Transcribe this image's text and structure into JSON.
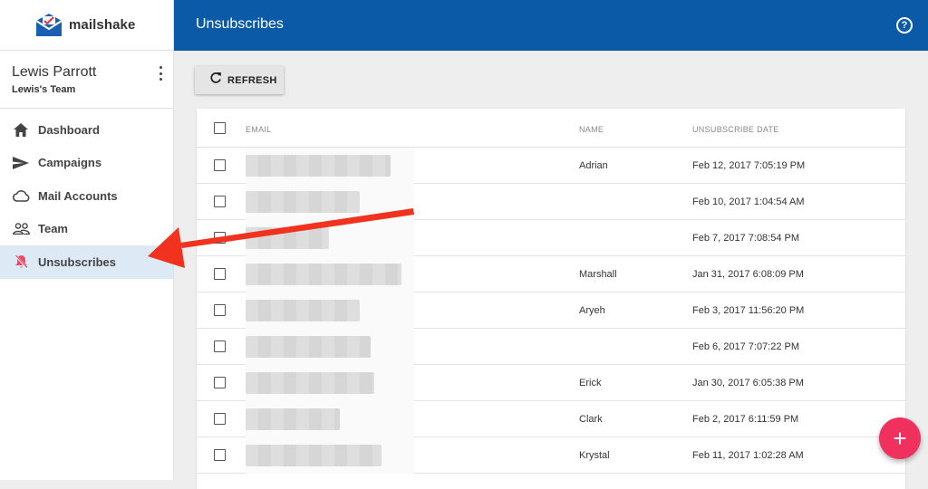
{
  "app": {
    "logo_text": "mailshake",
    "brand_color": "#0b5aa8"
  },
  "user": {
    "name": "Lewis Parrott",
    "team": "Lewis's Team"
  },
  "sidebar": {
    "items": [
      {
        "label": "Dashboard",
        "icon": "home-icon"
      },
      {
        "label": "Campaigns",
        "icon": "send-icon"
      },
      {
        "label": "Mail Accounts",
        "icon": "cloud-icon"
      },
      {
        "label": "Team",
        "icon": "people-icon"
      },
      {
        "label": "Unsubscribes",
        "icon": "bell-off-icon",
        "active": true
      }
    ]
  },
  "header": {
    "title": "Unsubscribes",
    "help": "?"
  },
  "toolbar": {
    "refresh_label": "REFRESH"
  },
  "table": {
    "columns": {
      "email": "EMAIL",
      "name": "NAME",
      "date": "UNSUBSCRIBE DATE"
    },
    "rows": [
      {
        "name": "Adrian",
        "date": "Feb 12, 2017 7:05:19 PM"
      },
      {
        "name": "",
        "date": "Feb 10, 2017 1:04:54 AM"
      },
      {
        "name": "",
        "date": "Feb 7, 2017 7:08:54 PM"
      },
      {
        "name": "Marshall",
        "date": "Jan 31, 2017 6:08:09 PM"
      },
      {
        "name": "Aryeh",
        "date": "Feb 3, 2017 11:56:20 PM"
      },
      {
        "name": "",
        "date": "Feb 6, 2017 7:07:22 PM"
      },
      {
        "name": "Erick",
        "date": "Jan 30, 2017 6:05:38 PM"
      },
      {
        "name": "Clark",
        "date": "Feb 2, 2017 6:11:59 PM"
      },
      {
        "name": "Krystal",
        "date": "Feb 11, 2017 1:02:28 AM"
      }
    ]
  },
  "fab": {
    "label": "+"
  },
  "annotation": {
    "arrow_color": "#f0321e"
  }
}
